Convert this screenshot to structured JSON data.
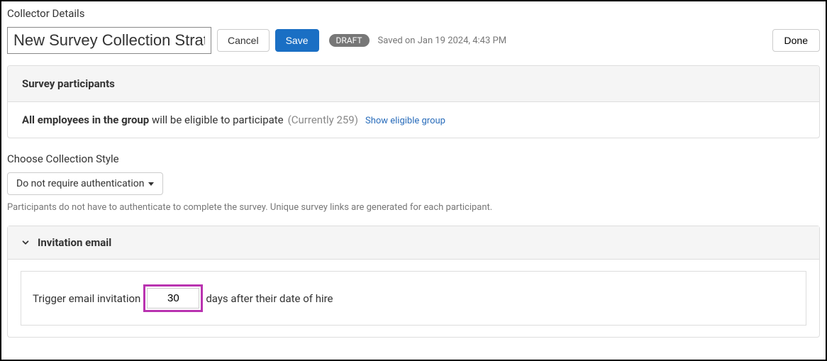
{
  "page": {
    "title": "Collector Details"
  },
  "header": {
    "name_value": "New Survey Collection Strategy",
    "cancel_label": "Cancel",
    "save_label": "Save",
    "status_badge": "DRAFT",
    "saved_text": "Saved on Jan 19 2024, 4:43 PM",
    "done_label": "Done"
  },
  "participants": {
    "panel_title": "Survey participants",
    "bold_part": "All employees in the group",
    "rest_part": " will be eligible to participate",
    "count_text": "(Currently 259)",
    "link_text": "Show eligible group"
  },
  "collection_style": {
    "label": "Choose Collection Style",
    "selected": "Do not require authentication",
    "help_text": "Participants do not have to authenticate to complete the survey. Unique survey links are generated for each participant."
  },
  "invitation": {
    "title": "Invitation email",
    "prefix_text": "Trigger email invitation",
    "days_value": "30",
    "suffix_text": "days after their date of hire"
  }
}
